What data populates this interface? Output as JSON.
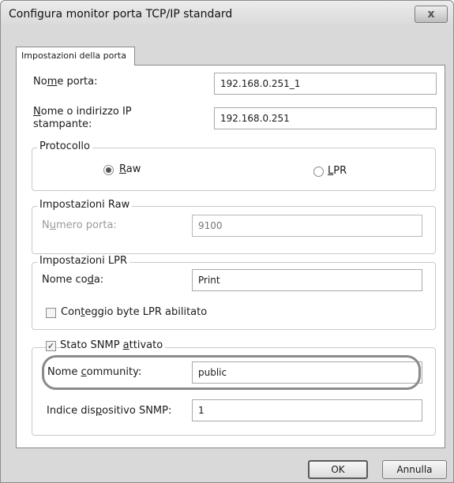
{
  "window": {
    "title": "Configura monitor porta TCP/IP standard",
    "close_symbol": "x"
  },
  "tab": {
    "label": "Impostazioni della porta"
  },
  "fields": {
    "port_name": {
      "label_pre": "No",
      "label_accel": "m",
      "label_post": "e porta:",
      "value": "192.168.0.251_1"
    },
    "printer_address": {
      "label_line1_accel": "N",
      "label_line1_post": "ome o indirizzo IP",
      "label_line2": "stampante:",
      "value": "192.168.0.251"
    }
  },
  "protocol": {
    "legend": "Protocollo",
    "raw": {
      "accel": "R",
      "rest": "aw",
      "checked": true
    },
    "lpr": {
      "accel": "L",
      "rest": "PR",
      "checked": false
    }
  },
  "raw_settings": {
    "legend": "Impostazioni Raw",
    "port_number": {
      "label_pre": "N",
      "label_accel": "u",
      "label_post": "mero porta:",
      "value": "9100"
    }
  },
  "lpr_settings": {
    "legend": "Impostazioni LPR",
    "queue_name": {
      "label_pre": "Nome co",
      "label_accel": "d",
      "label_post": "a:",
      "value": "Print"
    },
    "byte_count": {
      "label_pre": "Con",
      "label_accel": "t",
      "label_post": "eggio byte LPR abilitato",
      "checked": false
    }
  },
  "snmp": {
    "enabled": {
      "label_pre": "Stato SNMP ",
      "label_accel": "a",
      "label_post": "ttivato",
      "checked": true
    },
    "community": {
      "label_pre": "Nome ",
      "label_accel": "c",
      "label_post": "ommunity:",
      "value": "public"
    },
    "device_index": {
      "label_pre": "Indice dis",
      "label_accel": "p",
      "label_post": "ositivo SNMP:",
      "value": "1"
    }
  },
  "buttons": {
    "ok": "OK",
    "cancel": "Annulla"
  }
}
